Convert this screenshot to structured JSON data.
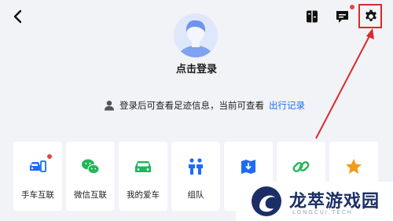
{
  "colors": {
    "accent": "#1d6cf5",
    "green": "#23b55a",
    "orange": "#f39a1d",
    "badge": "#e94343",
    "annotation": "#d92b2b"
  },
  "header": {
    "icons": [
      "back-arrow-icon",
      "book-icon",
      "message-icon",
      "gear-icon"
    ]
  },
  "profile": {
    "login_label": "点击登录"
  },
  "hint": {
    "text": "登录后可查看足迹信息，当前可查看",
    "link": "出行记录"
  },
  "shortcuts": [
    {
      "label": "手车互联",
      "icon": "car-phone-icon"
    },
    {
      "label": "微信互联",
      "icon": "wechat-icon"
    },
    {
      "label": "我的爱车",
      "icon": "car-icon"
    },
    {
      "label": "组队",
      "icon": "team-icon"
    },
    {
      "label": "",
      "icon": "map-download-icon"
    },
    {
      "label": "",
      "icon": "link-icon"
    },
    {
      "label": "",
      "icon": "star-icon"
    }
  ],
  "watermark": {
    "title": "龙萃游戏园",
    "subtitle": "LONGCUI.TECH"
  }
}
